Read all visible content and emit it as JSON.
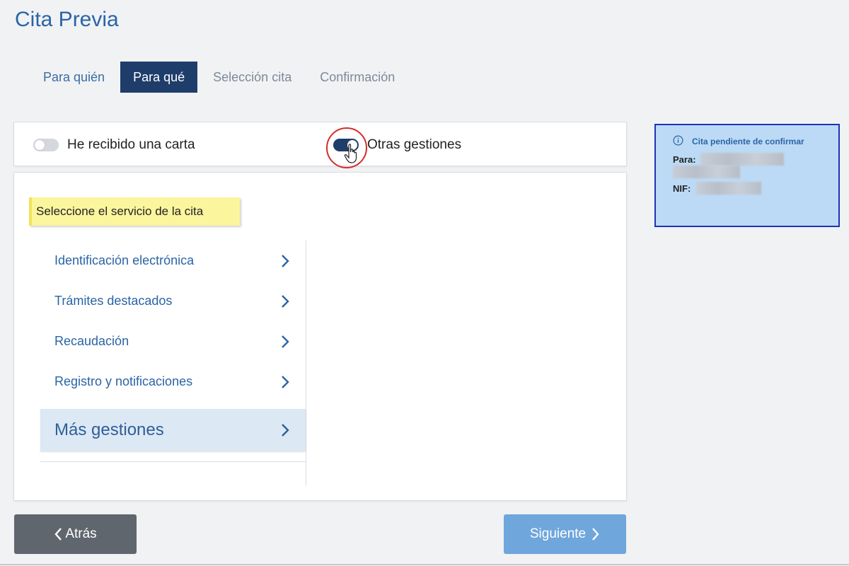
{
  "header": {
    "title": "Cita Previa"
  },
  "steps": [
    {
      "label": "Para quién",
      "state": "done"
    },
    {
      "label": "Para qué",
      "state": "active"
    },
    {
      "label": "Selección cita",
      "state": "future"
    },
    {
      "label": "Confirmación",
      "state": "future"
    }
  ],
  "toggles": {
    "letter": {
      "label": "He recibido una carta",
      "on": false
    },
    "other": {
      "label": "Otras gestiones",
      "on": true
    }
  },
  "hint": "Seleccione el servicio de la cita",
  "menu": {
    "items": [
      {
        "label": "Identificación electrónica",
        "icon": "chevron-right-icon"
      },
      {
        "label": "Trámites destacados",
        "icon": "chevron-right-icon"
      },
      {
        "label": "Recaudación",
        "icon": "chevron-right-icon"
      },
      {
        "label": "Registro y notificaciones",
        "icon": "chevron-right-icon"
      },
      {
        "label": "Más gestiones",
        "icon": "chevron-right-icon",
        "selected": true
      }
    ]
  },
  "info_box": {
    "heading": "Cita pendiente de confirmar",
    "para_label": "Para:",
    "nif_label": "NIF:",
    "icon": "info-icon"
  },
  "buttons": {
    "back": "Atrás",
    "next": "Siguiente"
  },
  "colors": {
    "brand": "#2a64a6",
    "active_step": "#1f3d6b",
    "hint_bg": "#fbf59d",
    "info_bg": "#bcdaf5",
    "info_border": "#1c33b8",
    "back_btn": "#5f666d",
    "next_btn": "#6fa6dc",
    "highlight_ring": "#d62b2b"
  }
}
